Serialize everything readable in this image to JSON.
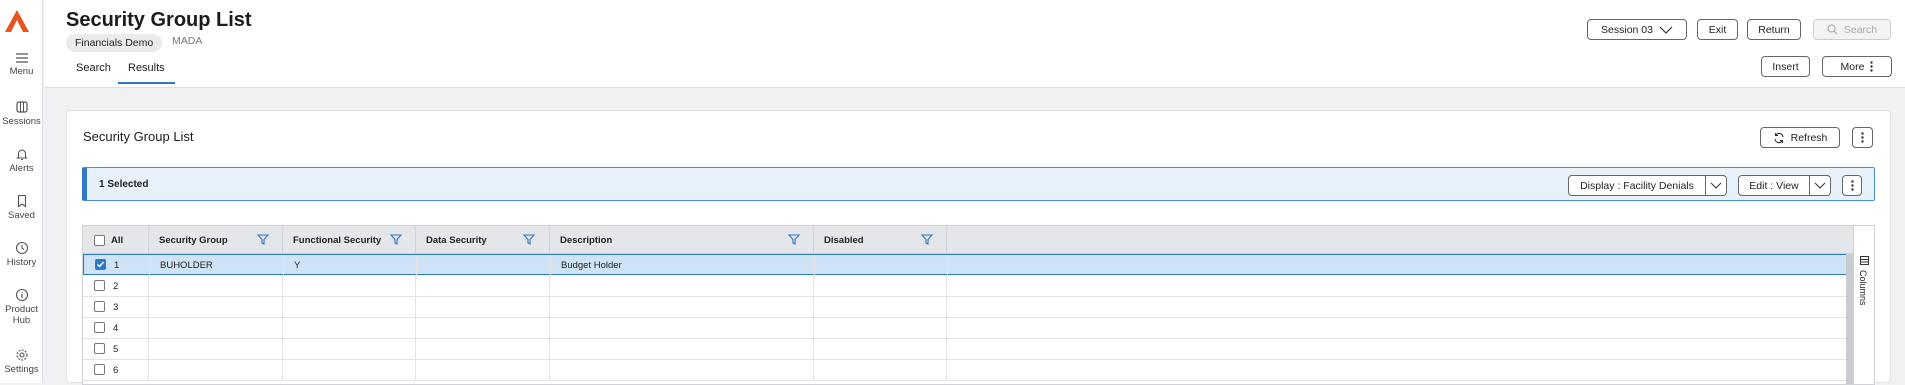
{
  "rail": {
    "items": [
      {
        "label": "Menu",
        "icon": "hamburger-icon"
      },
      {
        "label": "Sessions",
        "icon": "sessions-icon"
      },
      {
        "label": "Alerts",
        "icon": "bell-icon"
      },
      {
        "label": "Saved",
        "icon": "bookmark-icon"
      },
      {
        "label": "History",
        "icon": "clock-icon"
      },
      {
        "label": "Product",
        "label2": "Hub",
        "icon": "info-icon"
      },
      {
        "label": "Settings",
        "icon": "gear-icon"
      }
    ]
  },
  "header": {
    "title": "Security Group List",
    "context_badge": "Financials Demo",
    "context_sub": "MADA",
    "tabs": [
      "Search",
      "Results"
    ],
    "active_tab": "Results",
    "session_label": "Session 03",
    "exit_label": "Exit",
    "return_label": "Return",
    "search_label": "Search",
    "insert_label": "Insert",
    "more_label": "More"
  },
  "card": {
    "title": "Security Group List",
    "refresh_label": "Refresh",
    "selected_text": "1 Selected",
    "display_label": "Display : Facility Denials",
    "edit_label": "Edit : View",
    "columns_label": "Columns"
  },
  "grid": {
    "all_label": "All",
    "columns": [
      "Security Group",
      "Functional Security",
      "Data Security",
      "Description",
      "Disabled"
    ],
    "rows": [
      {
        "num": "1",
        "checked": true,
        "cells": [
          "BUHOLDER",
          "Y",
          "",
          "Budget Holder",
          ""
        ]
      },
      {
        "num": "2",
        "checked": false,
        "cells": [
          "",
          "",
          "",
          "",
          ""
        ]
      },
      {
        "num": "3",
        "checked": false,
        "cells": [
          "",
          "",
          "",
          "",
          ""
        ]
      },
      {
        "num": "4",
        "checked": false,
        "cells": [
          "",
          "",
          "",
          "",
          ""
        ]
      },
      {
        "num": "5",
        "checked": false,
        "cells": [
          "",
          "",
          "",
          "",
          ""
        ]
      },
      {
        "num": "6",
        "checked": false,
        "cells": [
          "",
          "",
          "",
          "",
          ""
        ]
      }
    ]
  },
  "colors": {
    "accent": "#2f79c4",
    "logo": "#e8541f",
    "selected_row": "#cfe3f6"
  }
}
